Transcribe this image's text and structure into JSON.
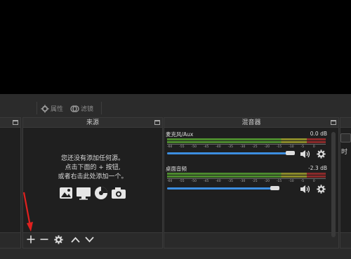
{
  "toolbar": {
    "properties_label": "属性",
    "filters_label": "滤镜"
  },
  "sources": {
    "title": "来源",
    "empty_lines": [
      "您还没有添加任何源。",
      "点击下面的 + 按钮,",
      "或者右击此处添加一个。"
    ],
    "add_icon": "plus-icon",
    "remove_icon": "minus-icon"
  },
  "mixer": {
    "title": "混音器",
    "channels": [
      {
        "name": "麦克风/Aux",
        "db": "0.0 dB",
        "volume_fraction": 0.79
      },
      {
        "name": "桌面音频",
        "db": "-2.3 dB",
        "volume_fraction": 0.69
      }
    ],
    "tick_labels": [
      "-60",
      "-55",
      "-50",
      "-45",
      "-40",
      "-35",
      "-30",
      "-25",
      "-20",
      "-15",
      "-10",
      "-5",
      "0"
    ]
  },
  "right_panel": {
    "partial_label": "时"
  },
  "colors": {
    "meter_green": "#4c8a2e",
    "meter_yellow": "#8a8a2a",
    "meter_red": "#8a2a2a",
    "slider_blue": "#3c8ee0",
    "arrow_red": "#e0201e"
  }
}
